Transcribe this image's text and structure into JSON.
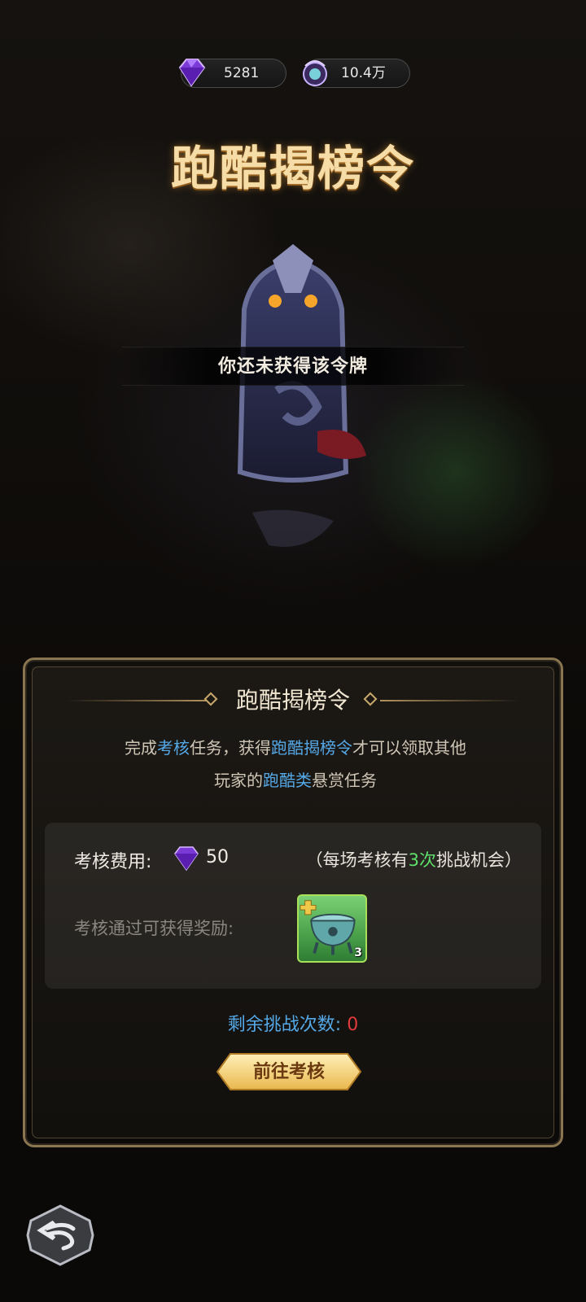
{
  "currency": {
    "gems": "5281",
    "orbs": "10.4万"
  },
  "title": "跑酷揭榜令",
  "token": {
    "status_text": "你还未获得该令牌"
  },
  "panel": {
    "title": "跑酷揭榜令",
    "desc": {
      "p1": "完成",
      "h1": "考核",
      "p2": "任务，获得",
      "h2": "跑酷揭榜令",
      "p3": "才可以领取其他",
      "p4": "玩家的",
      "h3": "跑酷类",
      "p5": "悬赏任务"
    },
    "cost_label": "考核费用:",
    "cost_value": "50",
    "chances_prefix": "（每场考核有",
    "chances_count": "3次",
    "chances_suffix": "挑战机会）",
    "reward_label": "考核通过可获得奖励:",
    "reward_count": "3",
    "remaining_label": "剩余挑战次数:",
    "remaining_value": "0",
    "go_button": "前往考核"
  },
  "colors": {
    "accent_blue": "#55a8e6",
    "accent_green": "#5fe06a",
    "accent_red": "#e23a3a",
    "frame_gold": "#8a7551"
  }
}
